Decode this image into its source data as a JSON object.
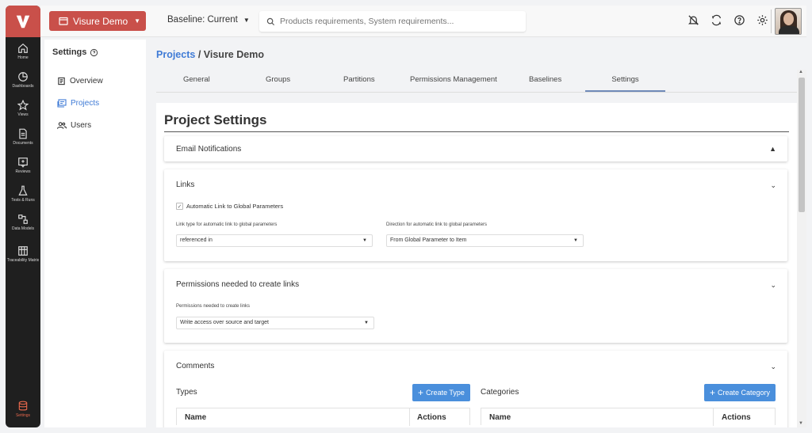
{
  "nav": {
    "items": [
      {
        "icon": "home-icon",
        "label": "Home"
      },
      {
        "icon": "dashboards-icon",
        "label": "Dashboards"
      },
      {
        "icon": "star-icon",
        "label": "Views"
      },
      {
        "icon": "document-icon",
        "label": "Documents"
      },
      {
        "icon": "review-icon",
        "label": "Reviews"
      },
      {
        "icon": "flask-icon",
        "label": "Tests & Runs"
      },
      {
        "icon": "data-models-icon",
        "label": "Data Models"
      },
      {
        "icon": "matrix-icon",
        "label": "Traceability Matrix"
      }
    ],
    "settings_label": "Settings"
  },
  "topbar": {
    "project": "Visure Demo",
    "baseline": "Baseline: Current",
    "search_placeholder": "Products requirements, System requirements..."
  },
  "sidebar": {
    "title": "Settings",
    "items": [
      {
        "label": "Overview"
      },
      {
        "label": "Projects"
      },
      {
        "label": "Users"
      }
    ]
  },
  "breadcrumb": {
    "link": "Projects",
    "sep": " / ",
    "current": "Visure Demo"
  },
  "tabs": [
    "General",
    "Groups",
    "Partitions",
    "Permissions Management",
    "Baselines",
    "Settings"
  ],
  "page": {
    "title": "Project Settings",
    "email": {
      "title": "Email Notifications"
    },
    "links": {
      "title": "Links",
      "auto_link_label": "Automatic Link to Global Parameters",
      "link_type_label": "Link type for automatic link to global parameters",
      "link_type_value": "referenced in",
      "direction_label": "Direction for automatic link to global parameters",
      "direction_value": "From Global Parameter to Item"
    },
    "permissions": {
      "title": "Permissions needed to create links",
      "field_label": "Permissions needed to create links",
      "field_value": "Write access over source and target"
    },
    "comments": {
      "title": "Comments",
      "types_label": "Types",
      "create_type": "Create Type",
      "categories_label": "Categories",
      "create_category": "Create Category",
      "col_name": "Name",
      "col_actions": "Actions"
    }
  },
  "colors": {
    "brand": "#c9504a",
    "accent": "#3f7bd6",
    "button": "#4a8fdc",
    "rail": "#1f1f1f"
  }
}
